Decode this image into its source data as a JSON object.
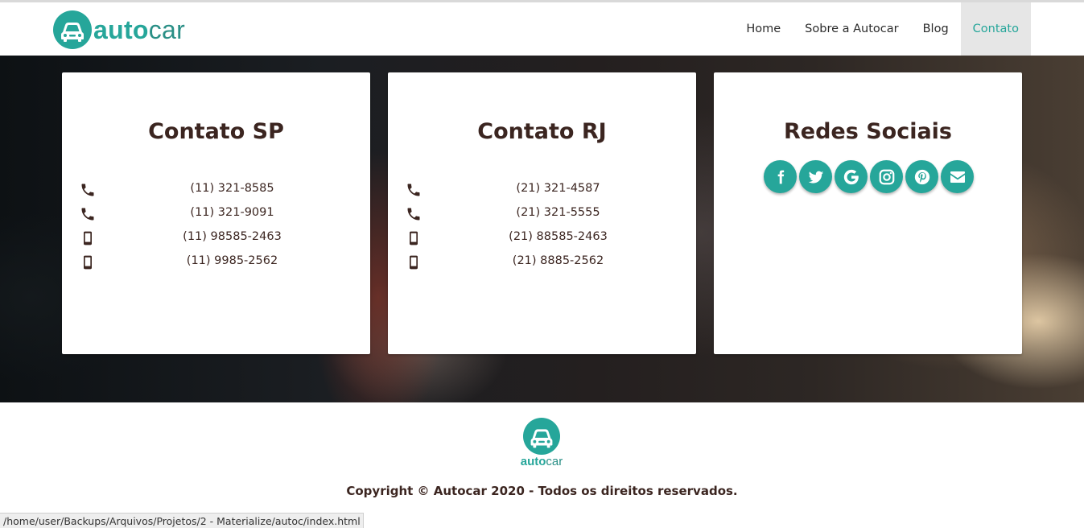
{
  "brand": {
    "logo_part1": "auto",
    "logo_part2": "car",
    "accent_color": "#26a69a"
  },
  "nav": {
    "items": [
      {
        "label": "Home",
        "active": false
      },
      {
        "label": "Sobre a Autocar",
        "active": false
      },
      {
        "label": "Blog",
        "active": false
      },
      {
        "label": "Contato",
        "active": true
      }
    ]
  },
  "contacts": {
    "sp": {
      "title": "Contato SP",
      "phones": [
        {
          "icon": "phone-icon",
          "number": "(11) 321-8585"
        },
        {
          "icon": "phone-icon",
          "number": "(11) 321-9091"
        },
        {
          "icon": "mobile-icon",
          "number": "(11) 98585-2463"
        },
        {
          "icon": "mobile-icon",
          "number": "(11) 9985-2562"
        }
      ]
    },
    "rj": {
      "title": "Contato RJ",
      "phones": [
        {
          "icon": "phone-icon",
          "number": "(21) 321-4587"
        },
        {
          "icon": "phone-icon",
          "number": "(21) 321-5555"
        },
        {
          "icon": "mobile-icon",
          "number": "(21) 88585-2463"
        },
        {
          "icon": "mobile-icon",
          "number": "(21) 8885-2562"
        }
      ]
    },
    "social": {
      "title": "Redes Sociais",
      "networks": [
        "facebook-icon",
        "twitter-icon",
        "google-icon",
        "instagram-icon",
        "pinterest-icon",
        "envelope-icon"
      ]
    }
  },
  "footer": {
    "logo_part1": "auto",
    "logo_part2": "car",
    "copyright": "Copyright © Autocar 2020 - Todos os direitos reservados."
  },
  "statusbar": {
    "url": "/home/user/Backups/Arquivos/Projetos/2 - Materialize/autoc/index.html"
  }
}
